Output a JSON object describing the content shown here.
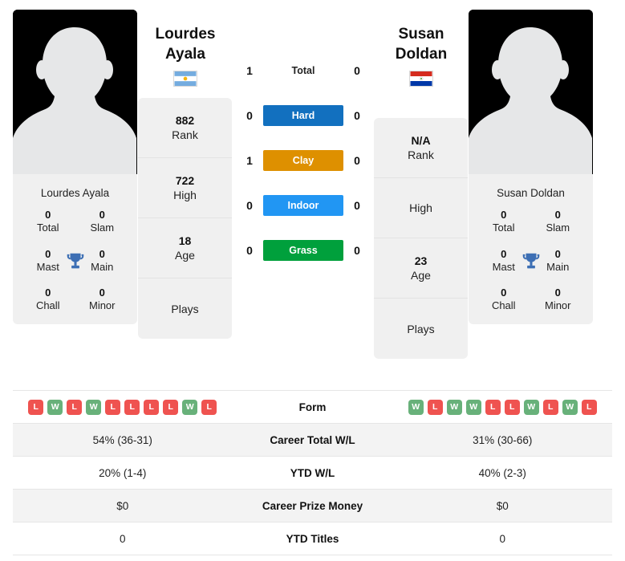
{
  "players": {
    "left": {
      "first_name": "Lourdes",
      "last_name": "Ayala",
      "full_name": "Lourdes Ayala",
      "flag_country": "Argentina",
      "flag_icon": "flag-argentina-icon",
      "avatar_icon": "player-avatar-placeholder-icon",
      "trophies": [
        {
          "value": "0",
          "label": "Total"
        },
        {
          "value": "0",
          "label": "Slam"
        },
        {
          "value": "0",
          "label": "Mast"
        },
        {
          "value": "0",
          "label": "Main"
        },
        {
          "value": "0",
          "label": "Chall"
        },
        {
          "value": "0",
          "label": "Minor"
        }
      ],
      "rank_card": [
        {
          "value": "882",
          "label": "Rank"
        },
        {
          "value": "722",
          "label": "High"
        },
        {
          "value": "18",
          "label": "Age"
        },
        {
          "value": "",
          "label": "Plays"
        }
      ]
    },
    "right": {
      "first_name": "Susan",
      "last_name": "Doldan",
      "full_name": "Susan Doldan",
      "flag_country": "Paraguay",
      "flag_icon": "flag-paraguay-icon",
      "avatar_icon": "player-avatar-placeholder-icon",
      "trophies": [
        {
          "value": "0",
          "label": "Total"
        },
        {
          "value": "0",
          "label": "Slam"
        },
        {
          "value": "0",
          "label": "Mast"
        },
        {
          "value": "0",
          "label": "Main"
        },
        {
          "value": "0",
          "label": "Chall"
        },
        {
          "value": "0",
          "label": "Minor"
        }
      ],
      "rank_card": [
        {
          "value": "N/A",
          "label": "Rank"
        },
        {
          "value": "",
          "label": "High"
        },
        {
          "value": "23",
          "label": "Age"
        },
        {
          "value": "",
          "label": "Plays"
        }
      ]
    }
  },
  "head_to_head": {
    "rows": [
      {
        "label": "Total",
        "left": "1",
        "right": "0",
        "style": "plain",
        "color": ""
      },
      {
        "label": "Hard",
        "left": "0",
        "right": "0",
        "style": "pill",
        "color": "#1270bf"
      },
      {
        "label": "Clay",
        "left": "1",
        "right": "0",
        "style": "pill",
        "color": "#de9000"
      },
      {
        "label": "Indoor",
        "left": "0",
        "right": "0",
        "style": "pill",
        "color": "#2196f3"
      },
      {
        "label": "Grass",
        "left": "0",
        "right": "0",
        "style": "pill",
        "color": "#00a03c"
      }
    ]
  },
  "stats_table": {
    "form": {
      "label": "Form",
      "left": [
        "L",
        "W",
        "L",
        "W",
        "L",
        "L",
        "L",
        "L",
        "W",
        "L"
      ],
      "right": [
        "W",
        "L",
        "W",
        "W",
        "L",
        "L",
        "W",
        "L",
        "W",
        "L"
      ]
    },
    "rows": [
      {
        "label": "Career Total W/L",
        "left": "54% (36-31)",
        "right": "31% (30-66)"
      },
      {
        "label": "YTD W/L",
        "left": "20% (1-4)",
        "right": "40% (2-3)"
      },
      {
        "label": "Career Prize Money",
        "left": "$0",
        "right": "$0"
      },
      {
        "label": "YTD Titles",
        "left": "0",
        "right": "0"
      }
    ]
  },
  "theme": {
    "win_color": "#68b17a",
    "loss_color": "#ef5350",
    "panel_bg": "#f0f0f0",
    "stripe_bg": "#f3f3f3",
    "trophy_color": "#3d6fb4"
  }
}
